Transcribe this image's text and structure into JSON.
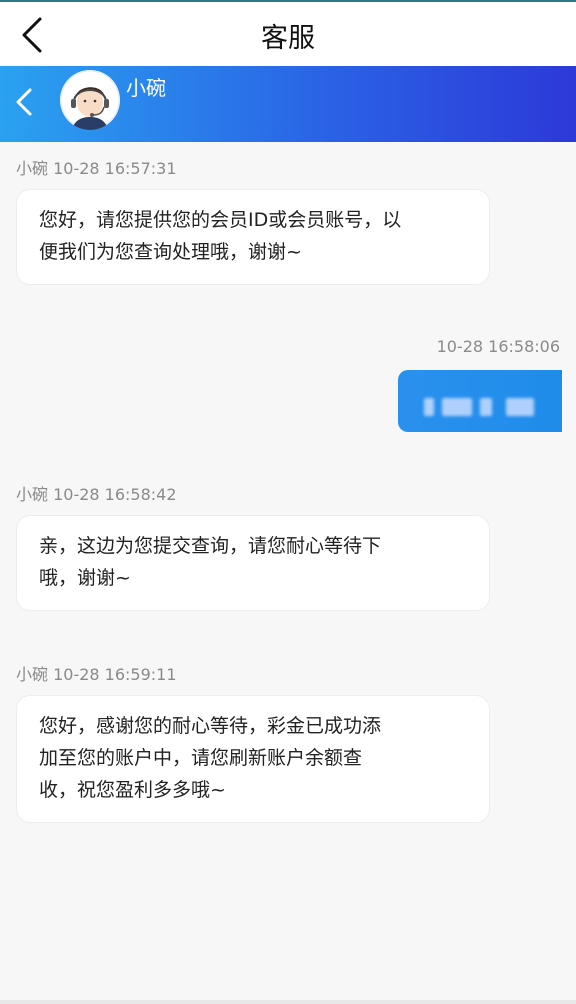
{
  "topbar": {
    "title": "客服"
  },
  "chat_header": {
    "agent_name": "小碗"
  },
  "messages": [
    {
      "meta": "小碗 10-28 16:57:31",
      "lines": [
        "您好，请您提供您的会员ID或会员账号，以",
        "便我们为您查询处理哦，谢谢~"
      ]
    },
    {
      "meta": "10-28 16:58:06"
    },
    {
      "meta": "小碗 10-28 16:58:42",
      "lines": [
        "亲，这边为您提交查询，请您耐心等待下",
        "哦，谢谢~"
      ]
    },
    {
      "meta": "小碗 10-28 16:59:11",
      "lines": [
        "您好，感谢您的耐心等待，彩金已成功添",
        "加至您的账户中，请您刷新账户余额查",
        "收，祝您盈利多多哦~"
      ]
    }
  ],
  "colors": {
    "header_start": "#2aa2f0",
    "header_end": "#2d39d8",
    "outgoing": "#1f8ce9"
  },
  "icons": {
    "top_back": "chevron-left-icon",
    "header_back": "chevron-left-icon",
    "avatar": "agent-avatar-icon"
  }
}
